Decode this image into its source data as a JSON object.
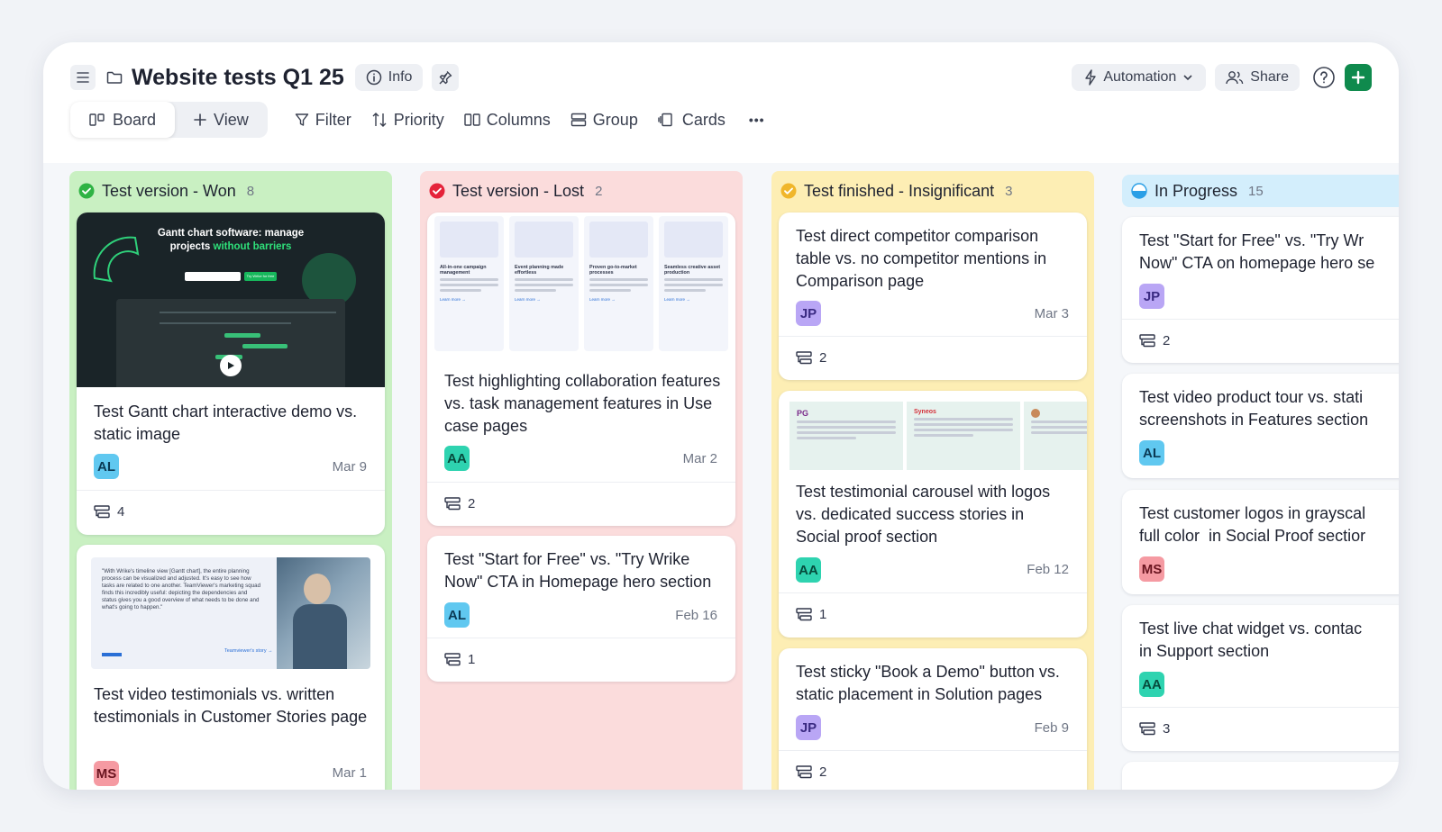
{
  "header": {
    "title": "Website tests Q1 25",
    "info_label": "Info",
    "automation_label": "Automation",
    "share_label": "Share"
  },
  "toolbar": {
    "board_label": "Board",
    "view_label": "View",
    "filter_label": "Filter",
    "priority_label": "Priority",
    "columns_label": "Columns",
    "group_label": "Group",
    "cards_label": "Cards",
    "more_label": "•••"
  },
  "columns": [
    {
      "title": "Test version - Won",
      "count": "8",
      "status_color": "#2fb344",
      "bg": "#c9f0c2",
      "cards": [
        {
          "title": "Test Gantt chart interactive demo vs. static image",
          "assignee": "AL",
          "date": "Mar 9",
          "subtasks": "4",
          "thumb": {
            "headline_a": "Gantt chart software: manage",
            "headline_b": "projects",
            "headline_c": "without barriers",
            "cta": "Try Wrike for free"
          }
        },
        {
          "title": "Test video testimonials vs. written testimonials in Customer Stories page",
          "assignee": "MS",
          "date": "Mar 1",
          "thumb": {
            "quote": "\"With Wrike's timeline view [Gantt chart], the entire planning process can be visualized and adjusted. It's easy to see how tasks are related to one another. TeamViewer's marketing squad finds this incredibly useful: depicting the dependencies and status gives you a good overview of what needs to be done and what's going to happen.\"",
            "link": "Teamviewer's story →"
          }
        }
      ]
    },
    {
      "title": "Test version - Lost",
      "count": "2",
      "status_color": "#e5233a",
      "bg": "#fbdcdc",
      "cards": [
        {
          "title": "Test highlighting collaboration features vs. task management features in Use case pages",
          "assignee": "AA",
          "date": "Mar 2",
          "subtasks": "2",
          "thumb": {
            "tiles": [
              "All-in-one campaign management",
              "Event planning made effortless",
              "Proven go-to-market processes",
              "Seamless creative asset production"
            ],
            "learn": "Learn more →"
          }
        },
        {
          "title": "Test \"Start for Free\" vs. \"Try Wrike Now\" CTA in Homepage hero section",
          "assignee": "AL",
          "date": "Feb 16",
          "subtasks": "1"
        }
      ]
    },
    {
      "title": "Test finished - Insignificant",
      "count": "3",
      "status_color": "#f0b62b",
      "bg": "#fdeeb4",
      "cards": [
        {
          "title": "Test direct competitor comparison table vs. no competitor mentions in Comparison page",
          "assignee": "JP",
          "date": "Mar 3",
          "subtasks": "2"
        },
        {
          "title": "Test testimonial carousel with logos vs. dedicated success stories in Social proof section",
          "assignee": "AA",
          "date": "Feb 12",
          "subtasks": "1",
          "thumb": {
            "logo_a": "PG",
            "logo_b": "Syneos"
          }
        },
        {
          "title": "Test sticky \"Book a Demo\" button vs. static placement in Solution pages",
          "assignee": "JP",
          "date": "Feb 9",
          "subtasks": "2"
        }
      ]
    },
    {
      "title": "In Progress",
      "count": "15",
      "status_color": "#2a9fe6",
      "bg": "#d3eefc",
      "cards": [
        {
          "title": "Test \"Start for Free\" vs. \"Try Wr Now\" CTA on homepage hero se",
          "assignee": "JP",
          "subtasks": "2"
        },
        {
          "title": "Test video product tour vs. stati screenshots in Features section",
          "assignee": "AL"
        },
        {
          "title": "Test customer logos in grayscal full color  in Social Proof sectior",
          "assignee": "MS"
        },
        {
          "title": "Test live chat widget vs. contac in Support section",
          "assignee": "AA",
          "subtasks": "3"
        }
      ]
    }
  ]
}
